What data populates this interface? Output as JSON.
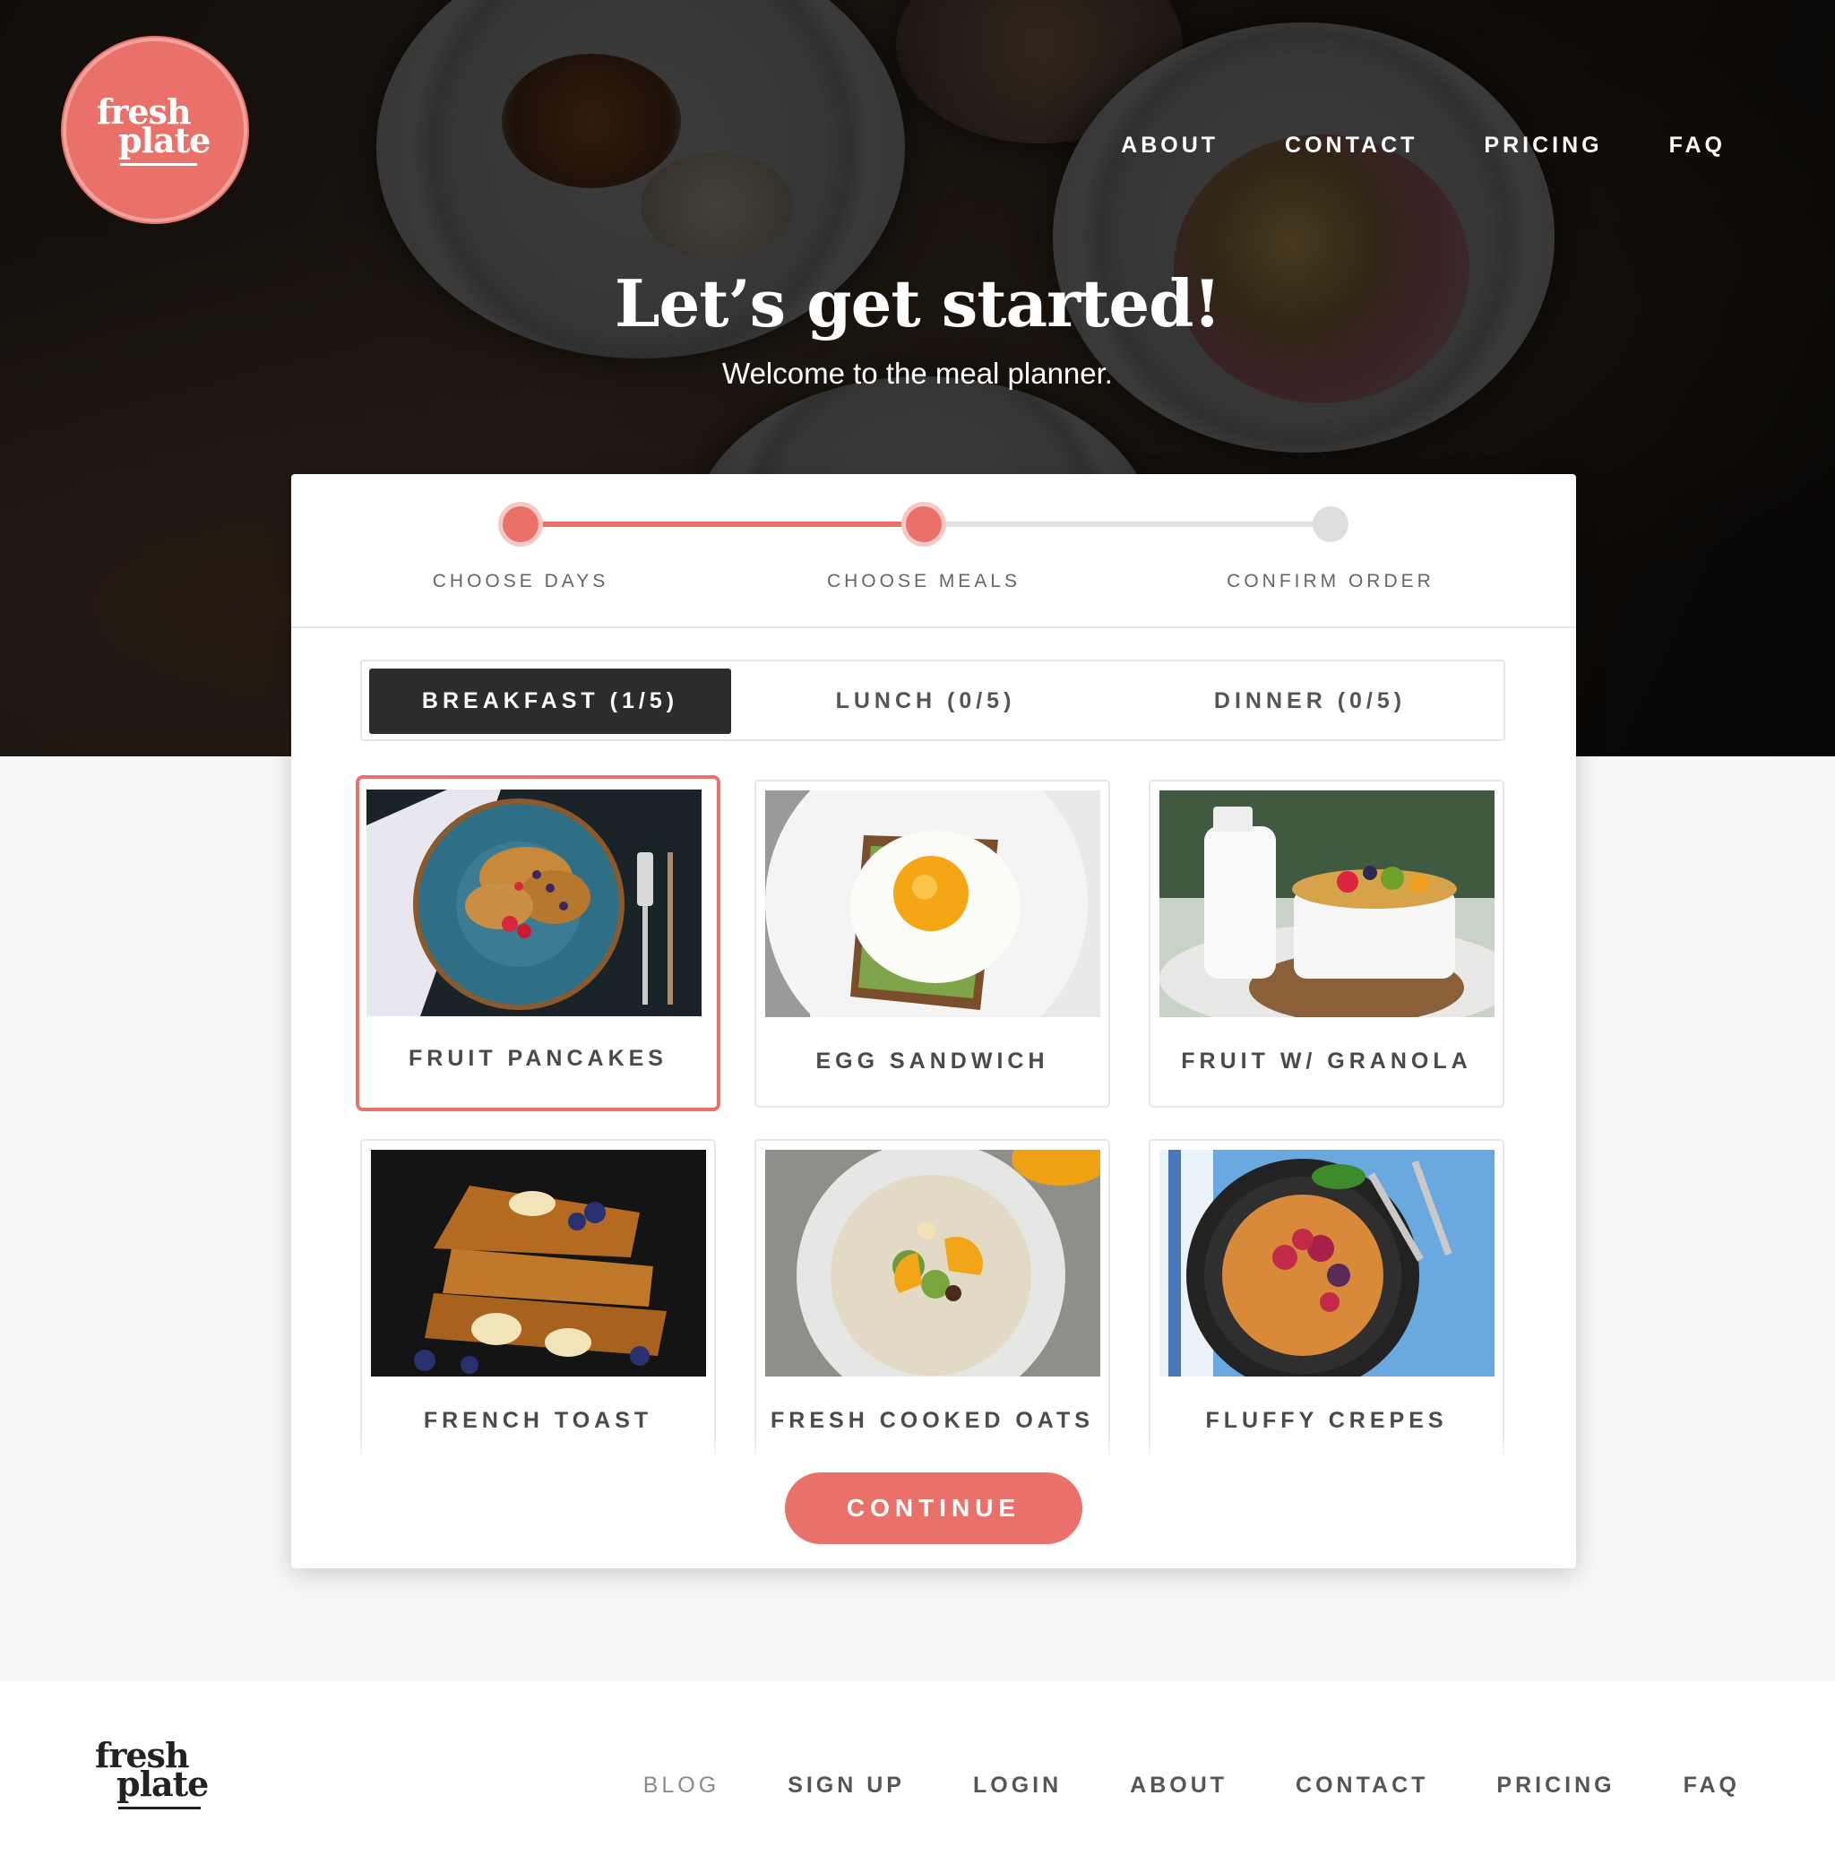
{
  "brand": {
    "logo_line1": "fresh",
    "logo_line2": "plate",
    "accent_color": "#ea7169"
  },
  "header": {
    "nav": [
      "ABOUT",
      "CONTACT",
      "PRICING",
      "FAQ"
    ]
  },
  "hero": {
    "title": "Let’s get started!",
    "subtitle": "Welcome to the meal planner."
  },
  "stepper": {
    "steps": [
      {
        "label": "CHOOSE DAYS",
        "state": "completed"
      },
      {
        "label": "CHOOSE MEALS",
        "state": "current"
      },
      {
        "label": "CONFIRM ORDER",
        "state": "pending"
      }
    ]
  },
  "tabs": [
    {
      "label": "BREAKFAST (1/5)",
      "active": true
    },
    {
      "label": "LUNCH (0/5)",
      "active": false
    },
    {
      "label": "DINNER (0/5)",
      "active": false
    }
  ],
  "meals": [
    {
      "name": "FRUIT PANCAKES",
      "selected": true
    },
    {
      "name": "EGG SANDWICH",
      "selected": false
    },
    {
      "name": "FRUIT W/ GRANOLA",
      "selected": false
    },
    {
      "name": "FRENCH TOAST",
      "selected": false
    },
    {
      "name": "FRESH COOKED OATS",
      "selected": false
    },
    {
      "name": "FLUFFY CREPES",
      "selected": false
    }
  ],
  "actions": {
    "continue_label": "CONTINUE"
  },
  "footer": {
    "nav": [
      "BLOG",
      "SIGN UP",
      "LOGIN",
      "ABOUT",
      "CONTACT",
      "PRICING",
      "FAQ"
    ]
  }
}
